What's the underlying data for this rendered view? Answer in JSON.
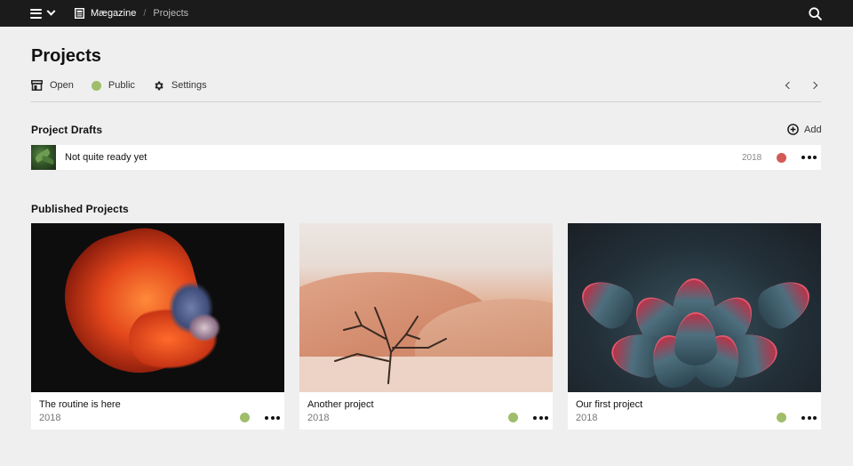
{
  "topbar": {
    "app_name": "Mægazine",
    "breadcrumb_separator": "/",
    "breadcrumb_current": "Projects"
  },
  "page": {
    "title": "Projects"
  },
  "actions": {
    "open_label": "Open",
    "public_label": "Public",
    "settings_label": "Settings"
  },
  "drafts": {
    "title": "Project Drafts",
    "add_label": "Add",
    "items": [
      {
        "title": "Not quite ready yet",
        "year": "2018",
        "status_color": "#d35a55"
      }
    ]
  },
  "published": {
    "title": "Published Projects",
    "items": [
      {
        "title": "The routine is here",
        "year": "2018",
        "status_color": "#9fbd6a"
      },
      {
        "title": "Another project",
        "year": "2018",
        "status_color": "#9fbd6a"
      },
      {
        "title": "Our first project",
        "year": "2018",
        "status_color": "#9fbd6a"
      }
    ]
  },
  "colors": {
    "topbar_bg": "#1b1b1b",
    "page_bg": "#efefef",
    "status_public": "#9fbd6a",
    "status_draft": "#d35a55"
  }
}
